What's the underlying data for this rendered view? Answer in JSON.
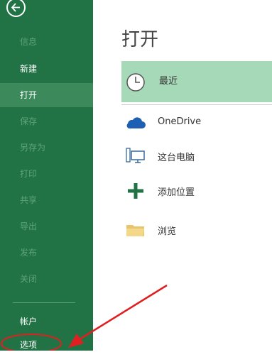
{
  "sidebar": {
    "items": [
      {
        "label": "信息",
        "state": "disabled"
      },
      {
        "label": "新建",
        "state": "normal"
      },
      {
        "label": "打开",
        "state": "active"
      },
      {
        "label": "保存",
        "state": "disabled"
      },
      {
        "label": "另存为",
        "state": "disabled"
      },
      {
        "label": "打印",
        "state": "disabled"
      },
      {
        "label": "共享",
        "state": "disabled"
      },
      {
        "label": "导出",
        "state": "disabled"
      },
      {
        "label": "发布",
        "state": "disabled"
      },
      {
        "label": "关闭",
        "state": "disabled"
      }
    ],
    "account_label": "帐户",
    "options_label": "选项"
  },
  "main": {
    "title": "打开",
    "locations": [
      {
        "label": "最近",
        "icon": "clock-icon",
        "selected": true
      },
      {
        "label": "OneDrive",
        "icon": "cloud-icon"
      },
      {
        "label": "这台电脑",
        "icon": "computer-icon"
      },
      {
        "label": "添加位置",
        "icon": "plus-icon"
      },
      {
        "label": "浏览",
        "icon": "folder-icon"
      }
    ]
  },
  "colors": {
    "sidebar_bg": "#217346",
    "sidebar_active": "#3c8a5b",
    "selected_row": "#a6d9b8",
    "annotation": "#e02020"
  }
}
